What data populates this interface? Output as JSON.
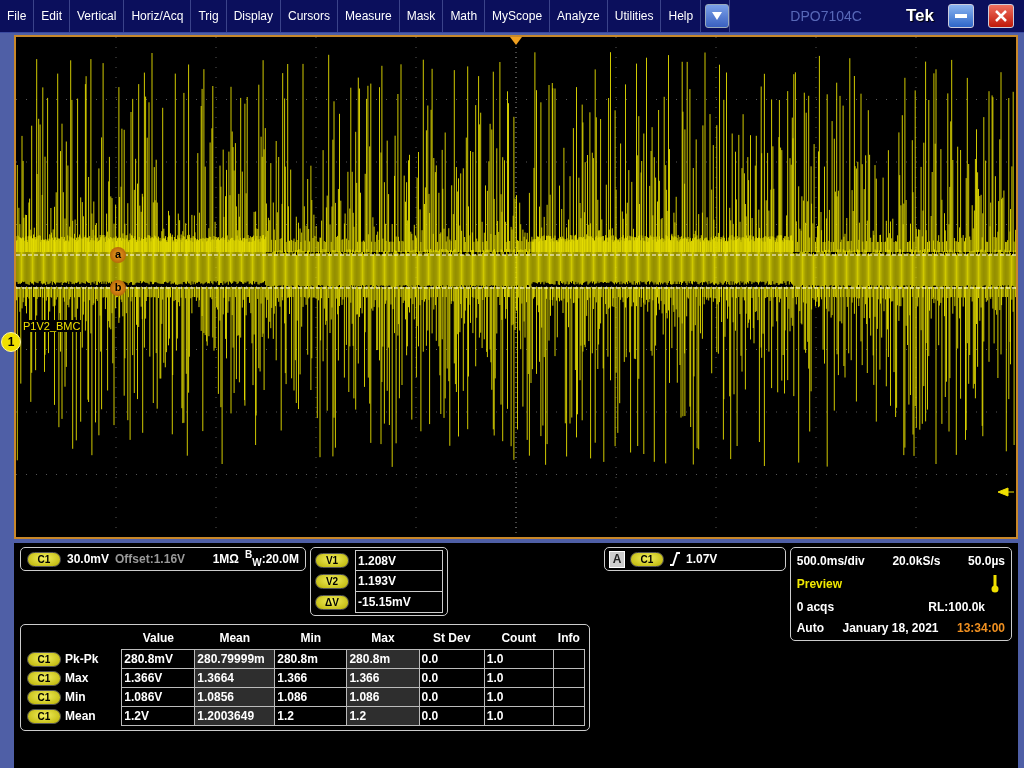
{
  "menu": [
    "File",
    "Edit",
    "Vertical",
    "Horiz/Acq",
    "Trig",
    "Display",
    "Cursors",
    "Measure",
    "Mask",
    "Math",
    "MyScope",
    "Analyze",
    "Utilities",
    "Help"
  ],
  "model": "DPO7104C",
  "brand": "Tek",
  "display": {
    "channel_label": "P1V2_BMC",
    "channel_marker": "1",
    "cursors": [
      {
        "label": "a"
      },
      {
        "label": "b"
      }
    ]
  },
  "channel": {
    "badge": "C1",
    "scale": "30.0mV",
    "offset": "Offset:1.16V",
    "impedance": "1MΩ",
    "bandwidth": "$^{B}$$_{W}$:20.0M"
  },
  "cursor_readout": [
    {
      "badge": "V1",
      "value": "1.208V"
    },
    {
      "badge": "V2",
      "value": "1.193V"
    },
    {
      "badge": "ΔV",
      "value": "-15.15mV"
    }
  ],
  "trigger": {
    "source": "A",
    "badge": "C1",
    "level": "1.07V"
  },
  "horizontal": {
    "scale": "500.0ms/div",
    "rate": "20.0kS/s",
    "position": "50.0µs",
    "mode": "Preview",
    "acqs": "0 acqs",
    "record": "RL:100.0k",
    "run": "Auto",
    "date": "January 18, 2021",
    "time": "13:34:00"
  },
  "measurements": {
    "columns": [
      "Value",
      "Mean",
      "Min",
      "Max",
      "St Dev",
      "Count",
      "Info"
    ],
    "rows": [
      {
        "badge": "C1",
        "name": "Pk-Pk",
        "cells": [
          "280.8mV",
          "280.79999m",
          "280.8m",
          "280.8m",
          "0.0",
          "1.0"
        ]
      },
      {
        "badge": "C1",
        "name": "Max",
        "cells": [
          "1.366V",
          "1.3664",
          "1.366",
          "1.366",
          "0.0",
          "1.0"
        ]
      },
      {
        "badge": "C1",
        "name": "Min",
        "cells": [
          "1.086V",
          "1.0856",
          "1.086",
          "1.086",
          "0.0",
          "1.0"
        ]
      },
      {
        "badge": "C1",
        "name": "Mean",
        "cells": [
          "1.2V",
          "1.2003649",
          "1.2",
          "1.2",
          "0.0",
          "1.0"
        ]
      }
    ]
  }
}
